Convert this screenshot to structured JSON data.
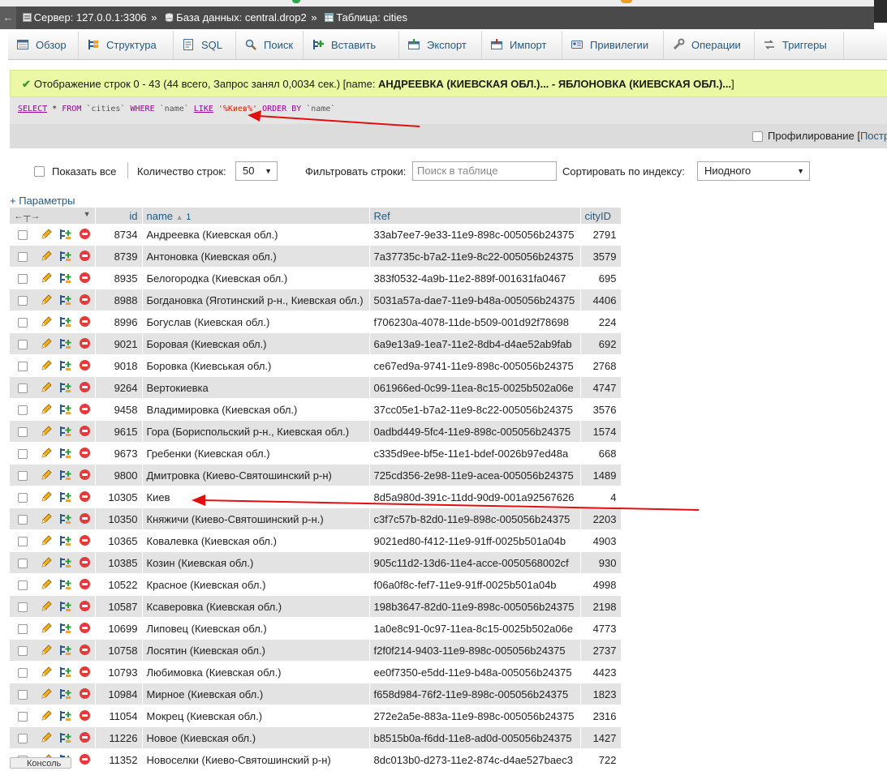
{
  "breadcrumb": {
    "server": "Сервер: 127.0.0.1:3306",
    "database": "База данных: central.drop2",
    "table": "Таблица: cities",
    "separator": "»"
  },
  "tabs": [
    {
      "label": "Обзор",
      "icon": "browse-icon"
    },
    {
      "label": "Структура",
      "icon": "structure-icon"
    },
    {
      "label": "SQL",
      "icon": "sql-icon"
    },
    {
      "label": "Поиск",
      "icon": "search-icon"
    },
    {
      "label": "Вставить",
      "icon": "insert-icon"
    },
    {
      "label": "Экспорт",
      "icon": "export-icon"
    },
    {
      "label": "Импорт",
      "icon": "import-icon"
    },
    {
      "label": "Привилегии",
      "icon": "privileges-icon"
    },
    {
      "label": "Операции",
      "icon": "operations-icon"
    },
    {
      "label": "Триггеры",
      "icon": "triggers-icon"
    }
  ],
  "success": {
    "prefix": "Отображение строк 0 - 43 (44 всего, Запрос занял 0,0034 сек.) [name: ",
    "bold": "АНДРЕЕВКА (КИЕВСКАЯ ОБЛ.)... - ЯБЛОНОВКА (КИЕВСКАЯ ОБЛ.)...",
    "suffix": "]"
  },
  "sql": {
    "select": "SELECT",
    "mid1": " * ",
    "from": "FROM",
    "table": " `cities` ",
    "where": "WHERE",
    "col": " `name` ",
    "like": "LIKE",
    "pattern": " '%Киев%' ",
    "orderby": "ORDER BY",
    "order_col": " `name`"
  },
  "profiling": {
    "label": "Профилирование [",
    "link": "Постр"
  },
  "controls": {
    "show_all": "Показать все",
    "rows_label": "Количество строк:",
    "rows_value": "50",
    "filter_label": "Фильтровать строки:",
    "filter_placeholder": "Поиск в таблице",
    "sort_label": "Сортировать по индексу:",
    "sort_value": "Ниодного",
    "params": "+ Параметры"
  },
  "table": {
    "columns": {
      "id": "id",
      "name": "name",
      "name_sort": "1",
      "ref": "Ref",
      "cityid": "cityID"
    },
    "rows": [
      {
        "id": "8734",
        "name": "Андреевка (Киевская обл.)",
        "ref": "33ab7ee7-9e33-11e9-898c-005056b24375",
        "cityid": "2791"
      },
      {
        "id": "8739",
        "name": "Антоновка (Киевская обл.)",
        "ref": "7a37735c-b7a2-11e9-8c22-005056b24375",
        "cityid": "3579"
      },
      {
        "id": "8935",
        "name": "Белогородка (Киевская обл.)",
        "ref": "383f0532-4a9b-11e2-889f-001631fa0467",
        "cityid": "695"
      },
      {
        "id": "8988",
        "name": "Богдановка (Яготинский р-н., Киевская обл.)",
        "ref": "5031a57a-dae7-11e9-b48a-005056b24375",
        "cityid": "4406"
      },
      {
        "id": "8996",
        "name": "Богуслав (Киевская обл.)",
        "ref": "f706230a-4078-11de-b509-001d92f78698",
        "cityid": "224"
      },
      {
        "id": "9021",
        "name": "Боровая (Киевская обл.)",
        "ref": "6a9e13a9-1ea7-11e2-8db4-d4ae52ab9fab",
        "cityid": "692"
      },
      {
        "id": "9018",
        "name": "Боровка (Киевськая обл.)",
        "ref": "ce67ed9a-9741-11e9-898c-005056b24375",
        "cityid": "2768"
      },
      {
        "id": "9264",
        "name": "Вертокиевка",
        "ref": "061966ed-0c99-11ea-8c15-0025b502a06e",
        "cityid": "4747"
      },
      {
        "id": "9458",
        "name": "Владимировка (Киевская обл.)",
        "ref": "37cc05e1-b7a2-11e9-8c22-005056b24375",
        "cityid": "3576"
      },
      {
        "id": "9615",
        "name": "Гора (Бориспольский р-н., Киевская обл.)",
        "ref": "0adbd449-5fc4-11e9-898c-005056b24375",
        "cityid": "1574"
      },
      {
        "id": "9673",
        "name": "Гребенки (Киевская обл.)",
        "ref": "c335d9ee-bf5e-11e1-bdef-0026b97ed48a",
        "cityid": "668"
      },
      {
        "id": "9800",
        "name": "Дмитровка (Киево-Святошинский р-н)",
        "ref": "725cd356-2e98-11e9-acea-005056b24375",
        "cityid": "1489"
      },
      {
        "id": "10305",
        "name": "Киев",
        "ref": "8d5a980d-391c-11dd-90d9-001a92567626",
        "cityid": "4"
      },
      {
        "id": "10350",
        "name": "Княжичи (Киево-Святошинский р-н.)",
        "ref": "c3f7c57b-82d0-11e9-898c-005056b24375",
        "cityid": "2203"
      },
      {
        "id": "10365",
        "name": "Ковалевка (Киевская обл.)",
        "ref": "9021ed80-f412-11e9-91ff-0025b501a04b",
        "cityid": "4903"
      },
      {
        "id": "10385",
        "name": "Козин (Киевская обл.)",
        "ref": "905c11d2-13d6-11e4-acce-0050568002cf",
        "cityid": "930"
      },
      {
        "id": "10522",
        "name": "Красное (Киевская обл.)",
        "ref": "f06a0f8c-fef7-11e9-91ff-0025b501a04b",
        "cityid": "4998"
      },
      {
        "id": "10587",
        "name": "Ксаверовка (Киевская обл.)",
        "ref": "198b3647-82d0-11e9-898c-005056b24375",
        "cityid": "2198"
      },
      {
        "id": "10699",
        "name": "Липовец (Киевская обл.)",
        "ref": "1a0e8c91-0c97-11ea-8c15-0025b502a06e",
        "cityid": "4773"
      },
      {
        "id": "10758",
        "name": "Лосятин (Киевская обл.)",
        "ref": "f2f0f214-9403-11e9-898c-005056b24375",
        "cityid": "2737"
      },
      {
        "id": "10793",
        "name": "Любимовка (Киевская обл.)",
        "ref": "ee0f7350-e5dd-11e9-b48a-005056b24375",
        "cityid": "4423"
      },
      {
        "id": "10984",
        "name": "Мирное (Киевская обл.)",
        "ref": "f658d984-76f2-11e9-898c-005056b24375",
        "cityid": "1823"
      },
      {
        "id": "11054",
        "name": "Мокрец (Киевская обл.)",
        "ref": "272e2a5e-883a-11e9-898c-005056b24375",
        "cityid": "2316"
      },
      {
        "id": "11226",
        "name": "Новое (Киевская обл.)",
        "ref": "b8515b0a-f6dd-11e8-ad0d-005056b24375",
        "cityid": "1427"
      },
      {
        "id": "11352",
        "name": "Новоселки (Киево-Святошинский р-н)",
        "ref": "8dc013b0-d273-11e2-874c-d4ae527baec3",
        "cityid": "722"
      }
    ]
  },
  "bottom": {
    "console": "Консоль"
  },
  "colors": {
    "link": "#235a81",
    "success_bg": "#ebf8a4",
    "arrow": "#e01010",
    "header_bg": "#4a4a4a"
  }
}
